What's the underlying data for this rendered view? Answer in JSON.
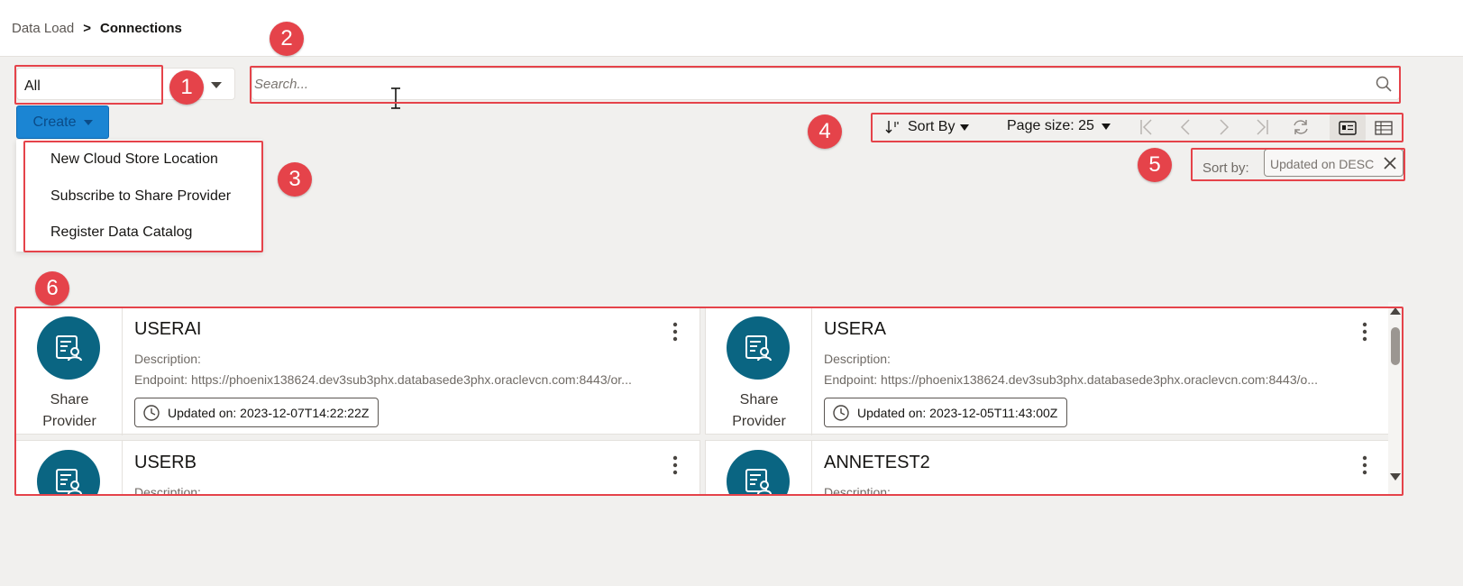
{
  "breadcrumb": {
    "parent": "Data Load",
    "separator": ">",
    "current": "Connections"
  },
  "filter": {
    "value": "All"
  },
  "search": {
    "placeholder": "Search..."
  },
  "create": {
    "label": "Create",
    "menu_items": [
      "New Cloud Store Location",
      "Subscribe to Share Provider",
      "Register Data Catalog"
    ]
  },
  "toolbar": {
    "sort_label": "Sort By",
    "page_size_label": "Page size: 25"
  },
  "sort": {
    "label": "Sort by:",
    "chip": "Updated on DESC"
  },
  "markers": [
    "1",
    "2",
    "3",
    "4",
    "5",
    "6"
  ],
  "cards": [
    {
      "name": "USERAI",
      "type_line1": "Share",
      "type_line2": "Provider",
      "description": "Description:",
      "endpoint": "Endpoint: https://phoenix138624.dev3sub3phx.databasede3phx.oraclevcn.com:8443/or...",
      "updated": "Updated on: 2023-12-07T14:22:22Z"
    },
    {
      "name": "USERA",
      "type_line1": "Share",
      "type_line2": "Provider",
      "description": "Description:",
      "endpoint": "Endpoint: https://phoenix138624.dev3sub3phx.databasede3phx.oraclevcn.com:8443/o...",
      "updated": "Updated on: 2023-12-05T11:43:00Z"
    },
    {
      "name": "USERB",
      "description": "Description:"
    },
    {
      "name": "ANNETEST2",
      "description": "Description:"
    }
  ],
  "colors": {
    "accent_red": "#e5434a",
    "create_button": "#1b85d3",
    "avatar": "#0a6582",
    "background": "#f1f0ee"
  },
  "icons": {
    "search": "search-icon",
    "clock": "clock-icon",
    "kebab": "kebab-icon",
    "refresh": "refresh-icon",
    "card_view": "card-view-icon",
    "table_view": "table-view-icon"
  }
}
